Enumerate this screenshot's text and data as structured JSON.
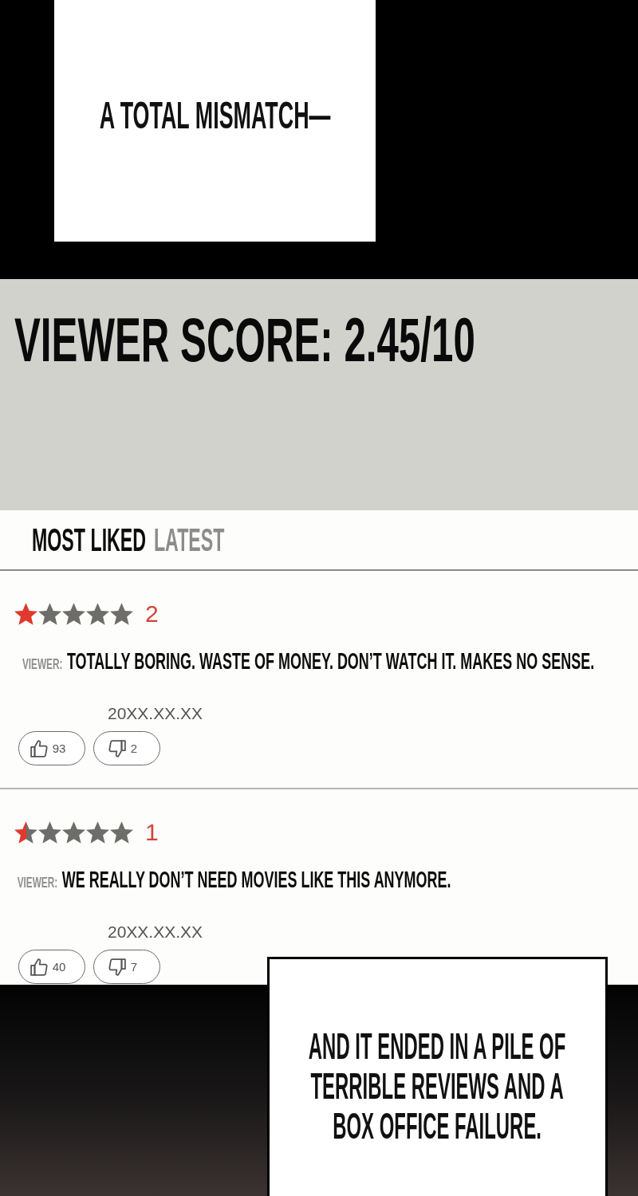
{
  "top_caption": {
    "text": "A TOTAL MISMATCH—"
  },
  "score_banner": {
    "text": "VIEWER SCORE: 2.45/10"
  },
  "tabs": [
    {
      "label": "MOST LIKED",
      "selected": true
    },
    {
      "label": "LATEST",
      "selected": false
    }
  ],
  "reviews": [
    {
      "stars": 1,
      "score": "2",
      "author": "VIEWER:",
      "text": "TOTALLY BORING. WASTE OF MONEY. DON’T WATCH IT. MAKES NO SENSE.",
      "date": "20XX.XX.XX",
      "likes": "93",
      "dislikes": "2"
    },
    {
      "stars": 0.5,
      "score": "1",
      "author": "VIEWER:",
      "text": "WE REALLY DON’T NEED MOVIES LIKE THIS ANYMORE.",
      "date": "20XX.XX.XX",
      "likes": "40",
      "dislikes": "7"
    }
  ],
  "bottom_caption": {
    "lines": [
      "AND IT ENDED IN A PILE OF",
      "TERRIBLE REVIEWS AND A",
      "BOX OFFICE FAILURE."
    ]
  }
}
